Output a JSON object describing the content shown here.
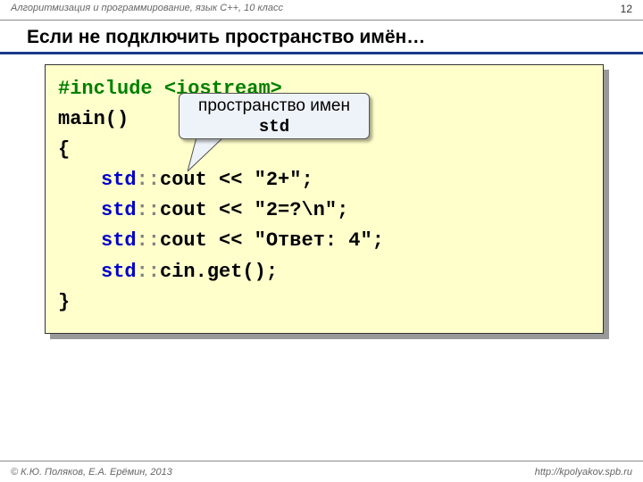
{
  "header": {
    "course": "Алгоритмизация и программирование, язык C++, 10 класс",
    "page": "12"
  },
  "title": "Если не подключить пространство имён…",
  "code": {
    "include_kw": "#include",
    "include_hdr": " <iostream>",
    "main": "main()",
    "brace_open": "{",
    "std": "std",
    "dcolon": "::",
    "cout": "cout",
    "cin": "cin",
    "op": " << ",
    "s1": "\"2+\"",
    "s2": "\"2=?\\n\"",
    "s3": "\"Ответ: 4\"",
    "get": ".get()",
    "semi": ";",
    "brace_close": "}"
  },
  "callout": {
    "line1": "пространство имен",
    "line2": "std"
  },
  "footer": {
    "copyright": "© К.Ю. Поляков, Е.А. Ерёмин, 2013",
    "url": "http://kpolyakov.spb.ru"
  }
}
